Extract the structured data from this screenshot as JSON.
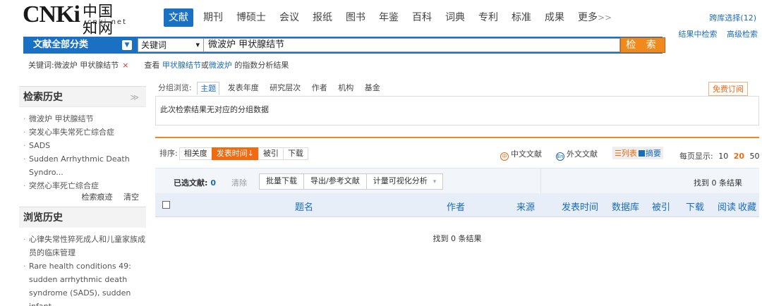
{
  "logo": {
    "mark": "CNKi",
    "cn": "中国知网",
    "url": "cnki.net"
  },
  "nav": {
    "items": [
      "文献",
      "期刊",
      "博硕士",
      "会议",
      "报纸",
      "图书",
      "年鉴",
      "百科",
      "词典",
      "专利",
      "标准",
      "成果",
      "更多"
    ],
    "more_arrow": ">>",
    "active": "文献"
  },
  "top_right": {
    "cross_db": "跨库选择(12)",
    "search_within": "结果中检索",
    "advanced": "高级检索"
  },
  "search": {
    "category_label": "文献全部分类",
    "field": "关键词",
    "query": "微波炉 甲状腺结节",
    "button": "检 索"
  },
  "crumb": {
    "keyword_text": "关键词:微波炉 甲状腺结节",
    "remove": "×",
    "view_prefix": "查看 ",
    "term1": "甲状腺结节",
    "or": "或",
    "term2": "微波炉",
    "suffix": " 的指数分析结果"
  },
  "sidebar": {
    "history_title": "检索历史",
    "collapse": "≫",
    "history": [
      "微波炉 甲状腺结节",
      "突发心率失常死亡综合症",
      "SADS",
      "Sudden Arrhythmic Death",
      "Syndro...",
      "突然心率死亡综合症"
    ],
    "history_trace": "检索痕迹",
    "clear": "清空",
    "browse_title": "浏览历史",
    "browse": [
      "心律失常性猝死成人和儿童家族成",
      "员的临床管理",
      "Rare health conditions 49:",
      "sudden arrhythmic death",
      "syndrome (SADS), sudden infant"
    ]
  },
  "group": {
    "label": "分组浏览:",
    "tabs": [
      "主题",
      "发表年度",
      "研究层次",
      "作者",
      "机构",
      "基金"
    ],
    "active": "主题",
    "subscribe": "免费订阅",
    "empty_msg": "此次检索结果无对应的分组数据"
  },
  "sort": {
    "label": "排序:",
    "options": [
      "相关度",
      "发表时间↓",
      "被引",
      "下载"
    ],
    "active": "发表时间↓",
    "cn_lit": "中文文献",
    "foreign_lit": "外文文献",
    "cn_icon": "中",
    "en_icon": "En",
    "view_list": "列表",
    "view_abstract": "摘要",
    "per_page_label": "每页显示:",
    "per_page": [
      "10",
      "20",
      "50"
    ],
    "per_page_current": "20"
  },
  "selection": {
    "selected_label": "已选文献:",
    "selected_count": "0",
    "clear": "清除",
    "batch_download": "批量下载",
    "export": "导出/参考文献",
    "visualize": "计量可视化分析",
    "visualize_caret": "▾",
    "found": "找到 0 条结果"
  },
  "table": {
    "headers": [
      "题名",
      "作者",
      "来源",
      "发表时间",
      "数据库",
      "被引",
      "下载",
      "阅读",
      "收藏"
    ]
  },
  "result": {
    "empty": "找到 0 条结果"
  },
  "colors": {
    "brand_blue": "#1a71c4",
    "accent_orange": "#f08a1c"
  }
}
